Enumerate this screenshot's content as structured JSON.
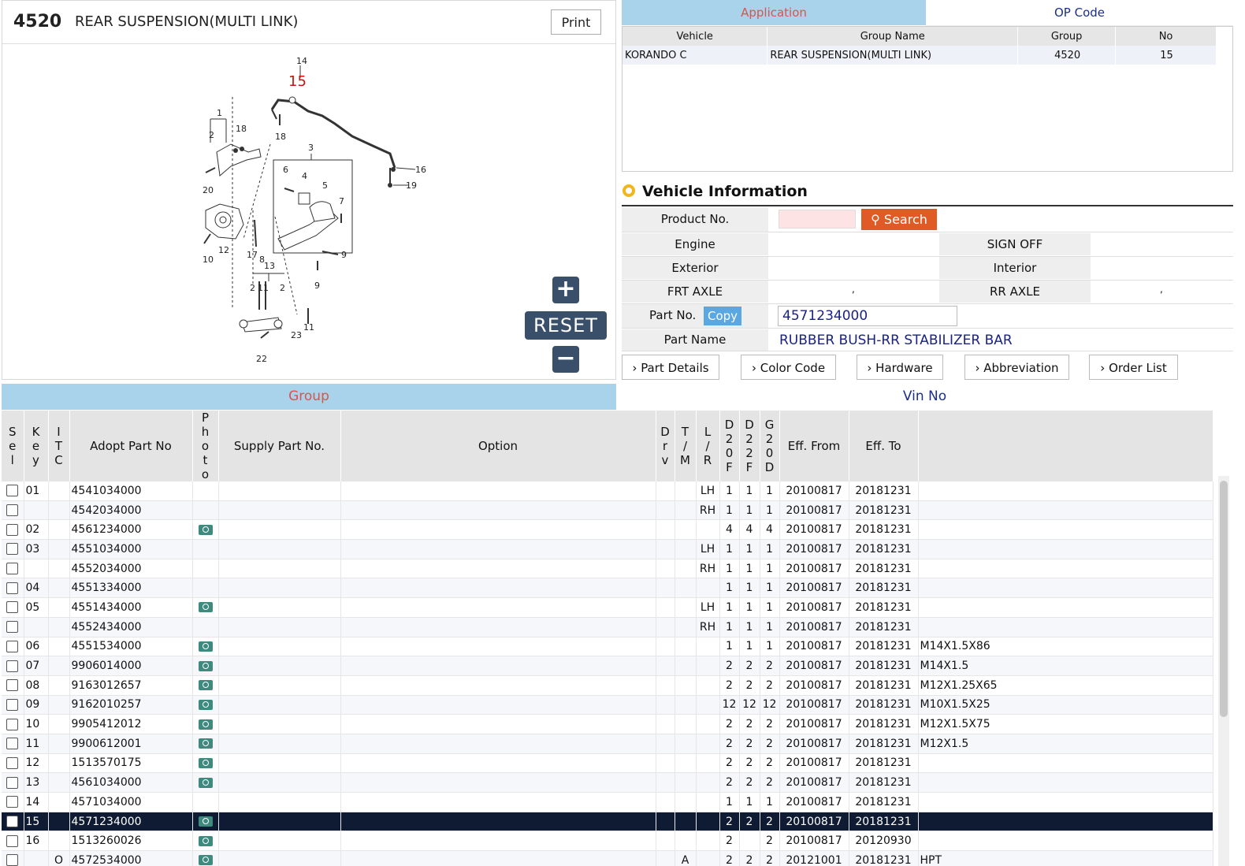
{
  "header": {
    "group_code": "4520",
    "group_title": "REAR SUSPENSION(MULTI LINK)",
    "print_label": "Print"
  },
  "diagram": {
    "highlight_label": "15",
    "callouts": [
      "14",
      "1",
      "2",
      "18",
      "18",
      "3",
      "6",
      "4",
      "5",
      "7",
      "20",
      "16",
      "19",
      "10",
      "12",
      "17",
      "8",
      "9",
      "9",
      "13",
      "2",
      "11",
      "2",
      "11",
      "23",
      "22"
    ],
    "reset_label": "RESET",
    "zoom_in_icon": "plus-icon",
    "zoom_out_icon": "minus-icon"
  },
  "application": {
    "tab_application": "Application",
    "tab_opcode": "OP Code",
    "columns": [
      "Vehicle",
      "Group Name",
      "Group",
      "No"
    ],
    "rows": [
      {
        "vehicle": "KORANDO C",
        "group_name": "REAR SUSPENSION(MULTI LINK)",
        "group": "4520",
        "no": "15"
      }
    ]
  },
  "vehicle_info": {
    "title": "Vehicle Information",
    "product_no_label": "Product No.",
    "product_no_value": "",
    "search_label": "Search",
    "engine_label": "Engine",
    "sign_off_label": "SIGN OFF",
    "exterior_label": "Exterior",
    "interior_label": "Interior",
    "frt_axle_label": "FRT AXLE",
    "frt_axle_value": ",",
    "rr_axle_label": "RR AXLE",
    "rr_axle_value": ",",
    "part_no_label": "Part No.",
    "copy_label": "Copy",
    "part_no_value": "4571234000",
    "part_name_label": "Part Name",
    "part_name_value": "RUBBER BUSH-RR STABILIZER BAR"
  },
  "actions": [
    "Part Details",
    "Color Code",
    "Hardware",
    "Abbreviation",
    "Order List"
  ],
  "bottom_tabs": {
    "group": "Group",
    "vin": "Vin No"
  },
  "grid": {
    "headers": {
      "sel": "Sel",
      "key": "Key",
      "itc": "ITC",
      "adopt": "Adopt Part No",
      "photo": "Photo",
      "supply": "Supply Part No.",
      "option": "Option",
      "drv": "Drv",
      "tm": "T/M",
      "lr": "L/R",
      "d20f": "D20F",
      "d22f": "D22F",
      "g20d": "G20D",
      "eff_from": "Eff. From",
      "eff_to": "Eff. To"
    },
    "rows": [
      {
        "key": "01",
        "itc": "",
        "adopt": "4541034000",
        "photo": false,
        "tm": "",
        "lr": "LH",
        "d20f": "1",
        "d22f": "1",
        "g20d": "1",
        "from": "20100817",
        "to": "20181231",
        "spec": ""
      },
      {
        "key": "",
        "itc": "",
        "adopt": "4542034000",
        "photo": false,
        "tm": "",
        "lr": "RH",
        "d20f": "1",
        "d22f": "1",
        "g20d": "1",
        "from": "20100817",
        "to": "20181231",
        "spec": ""
      },
      {
        "key": "02",
        "itc": "",
        "adopt": "4561234000",
        "photo": true,
        "tm": "",
        "lr": "",
        "d20f": "4",
        "d22f": "4",
        "g20d": "4",
        "from": "20100817",
        "to": "20181231",
        "spec": ""
      },
      {
        "key": "03",
        "itc": "",
        "adopt": "4551034000",
        "photo": false,
        "tm": "",
        "lr": "LH",
        "d20f": "1",
        "d22f": "1",
        "g20d": "1",
        "from": "20100817",
        "to": "20181231",
        "spec": ""
      },
      {
        "key": "",
        "itc": "",
        "adopt": "4552034000",
        "photo": false,
        "tm": "",
        "lr": "RH",
        "d20f": "1",
        "d22f": "1",
        "g20d": "1",
        "from": "20100817",
        "to": "20181231",
        "spec": ""
      },
      {
        "key": "04",
        "itc": "",
        "adopt": "4551334000",
        "photo": false,
        "tm": "",
        "lr": "",
        "d20f": "1",
        "d22f": "1",
        "g20d": "1",
        "from": "20100817",
        "to": "20181231",
        "spec": ""
      },
      {
        "key": "05",
        "itc": "",
        "adopt": "4551434000",
        "photo": true,
        "tm": "",
        "lr": "LH",
        "d20f": "1",
        "d22f": "1",
        "g20d": "1",
        "from": "20100817",
        "to": "20181231",
        "spec": ""
      },
      {
        "key": "",
        "itc": "",
        "adopt": "4552434000",
        "photo": false,
        "tm": "",
        "lr": "RH",
        "d20f": "1",
        "d22f": "1",
        "g20d": "1",
        "from": "20100817",
        "to": "20181231",
        "spec": ""
      },
      {
        "key": "06",
        "itc": "",
        "adopt": "4551534000",
        "photo": true,
        "tm": "",
        "lr": "",
        "d20f": "1",
        "d22f": "1",
        "g20d": "1",
        "from": "20100817",
        "to": "20181231",
        "spec": "M14X1.5X86"
      },
      {
        "key": "07",
        "itc": "",
        "adopt": "9906014000",
        "photo": true,
        "tm": "",
        "lr": "",
        "d20f": "2",
        "d22f": "2",
        "g20d": "2",
        "from": "20100817",
        "to": "20181231",
        "spec": "M14X1.5"
      },
      {
        "key": "08",
        "itc": "",
        "adopt": "9163012657",
        "photo": true,
        "tm": "",
        "lr": "",
        "d20f": "2",
        "d22f": "2",
        "g20d": "2",
        "from": "20100817",
        "to": "20181231",
        "spec": "M12X1.25X65"
      },
      {
        "key": "09",
        "itc": "",
        "adopt": "9162010257",
        "photo": true,
        "tm": "",
        "lr": "",
        "d20f": "12",
        "d22f": "12",
        "g20d": "12",
        "from": "20100817",
        "to": "20181231",
        "spec": "M10X1.5X25"
      },
      {
        "key": "10",
        "itc": "",
        "adopt": "9905412012",
        "photo": true,
        "tm": "",
        "lr": "",
        "d20f": "2",
        "d22f": "2",
        "g20d": "2",
        "from": "20100817",
        "to": "20181231",
        "spec": "M12X1.5X75"
      },
      {
        "key": "11",
        "itc": "",
        "adopt": "9900612001",
        "photo": true,
        "tm": "",
        "lr": "",
        "d20f": "2",
        "d22f": "2",
        "g20d": "2",
        "from": "20100817",
        "to": "20181231",
        "spec": "M12X1.5"
      },
      {
        "key": "12",
        "itc": "",
        "adopt": "1513570175",
        "photo": true,
        "tm": "",
        "lr": "",
        "d20f": "2",
        "d22f": "2",
        "g20d": "2",
        "from": "20100817",
        "to": "20181231",
        "spec": ""
      },
      {
        "key": "13",
        "itc": "",
        "adopt": "4561034000",
        "photo": true,
        "tm": "",
        "lr": "",
        "d20f": "2",
        "d22f": "2",
        "g20d": "2",
        "from": "20100817",
        "to": "20181231",
        "spec": ""
      },
      {
        "key": "14",
        "itc": "",
        "adopt": "4571034000",
        "photo": false,
        "tm": "",
        "lr": "",
        "d20f": "1",
        "d22f": "1",
        "g20d": "1",
        "from": "20100817",
        "to": "20181231",
        "spec": ""
      },
      {
        "key": "15",
        "itc": "",
        "adopt": "4571234000",
        "photo": true,
        "tm": "",
        "lr": "",
        "d20f": "2",
        "d22f": "2",
        "g20d": "2",
        "from": "20100817",
        "to": "20181231",
        "spec": "",
        "selected": true
      },
      {
        "key": "16",
        "itc": "",
        "adopt": "1513260026",
        "photo": true,
        "tm": "",
        "lr": "",
        "d20f": "2",
        "d22f": "",
        "g20d": "2",
        "from": "20100817",
        "to": "20120930",
        "spec": ""
      },
      {
        "key": "",
        "itc": "O",
        "adopt": "4572534000",
        "photo": true,
        "tm": "A",
        "lr": "",
        "d20f": "2",
        "d22f": "2",
        "g20d": "2",
        "from": "20121001",
        "to": "20181231",
        "spec": "HPT"
      }
    ]
  },
  "colors": {
    "tab_active": "#a9d3ea",
    "tab_active_text": "#d9534f",
    "search_button": "#e05a25",
    "copy_button": "#5aa7e2",
    "selected_row": "#0f1a33",
    "diagram_highlight": "#d01010"
  }
}
